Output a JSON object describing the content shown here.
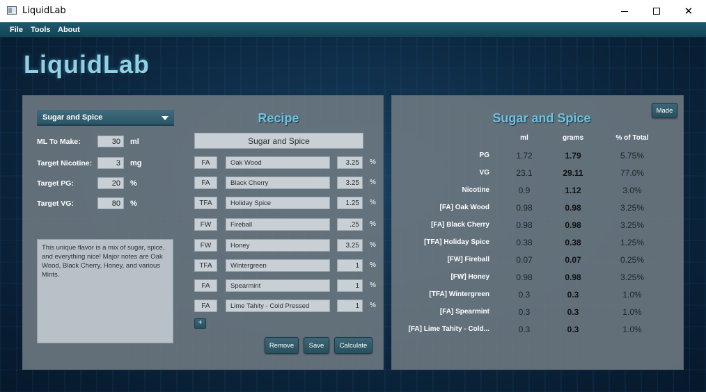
{
  "window": {
    "title": "LiquidLab",
    "controls": {
      "minimize": "–",
      "maximize": "□",
      "close": "✕"
    }
  },
  "menu": [
    "File",
    "Tools",
    "About"
  ],
  "logo": "LiquidLab",
  "left_panel": {
    "recipe_select": "Sugar and Spice",
    "params": [
      {
        "label": "ML To Make:",
        "value": "30",
        "unit": "ml"
      },
      {
        "label": "Target Nicotine:",
        "value": "3",
        "unit": "mg"
      },
      {
        "label": "Target PG:",
        "value": "20",
        "unit": "%"
      },
      {
        "label": "Target VG:",
        "value": "80",
        "unit": "%"
      }
    ],
    "description": "This unique flavor is a mix of sugar, spice, and everything nice! Major notes are Oak Wood, Black Cherry, Honey, and various Mints."
  },
  "recipe": {
    "title": "Recipe",
    "name": "Sugar and Spice",
    "flavors": [
      {
        "brand": "FA",
        "name": "Oak Wood",
        "pct": "3.25",
        "unit": "%"
      },
      {
        "brand": "FA",
        "name": "Black Cherry",
        "pct": "3.25",
        "unit": "%"
      },
      {
        "brand": "TFA",
        "name": "Holiday Spice",
        "pct": "1.25",
        "unit": "%"
      },
      {
        "brand": "FW",
        "name": "Fireball",
        "pct": ".25",
        "unit": "%"
      },
      {
        "brand": "FW",
        "name": "Honey",
        "pct": "3.25",
        "unit": "%"
      },
      {
        "brand": "TFA",
        "name": "Wintergreen",
        "pct": "1",
        "unit": "%"
      },
      {
        "brand": "FA",
        "name": "Spearmint",
        "pct": "1",
        "unit": "%"
      },
      {
        "brand": "FA",
        "name": "Lime Tahity - Cold Pressed",
        "pct": "1",
        "unit": "%"
      }
    ],
    "add_label": "+",
    "buttons": {
      "remove": "Remove",
      "save": "Save",
      "calculate": "Calculate"
    }
  },
  "results": {
    "made_label": "Made",
    "title": "Sugar and Spice",
    "columns": {
      "ml": "ml",
      "grams": "grams",
      "pct": "% of Total"
    },
    "rows": [
      {
        "label": "PG",
        "ml": "1.72",
        "grams": "1.79",
        "pct": "5.75%"
      },
      {
        "label": "VG",
        "ml": "23.1",
        "grams": "29.11",
        "pct": "77.0%"
      },
      {
        "label": "Nicotine",
        "ml": "0.9",
        "grams": "1.12",
        "pct": "3.0%"
      },
      {
        "label": "[FA] Oak Wood",
        "ml": "0.98",
        "grams": "0.98",
        "pct": "3.25%"
      },
      {
        "label": "[FA] Black Cherry",
        "ml": "0.98",
        "grams": "0.98",
        "pct": "3.25%"
      },
      {
        "label": "[TFA] Holiday Spice",
        "ml": "0.38",
        "grams": "0.38",
        "pct": "1.25%"
      },
      {
        "label": "[FW] Fireball",
        "ml": "0.07",
        "grams": "0.07",
        "pct": "0.25%"
      },
      {
        "label": "[FW] Honey",
        "ml": "0.98",
        "grams": "0.98",
        "pct": "3.25%"
      },
      {
        "label": "[TFA] Wintergreen",
        "ml": "0.3",
        "grams": "0.3",
        "pct": "1.0%"
      },
      {
        "label": "[FA] Spearmint",
        "ml": "0.3",
        "grams": "0.3",
        "pct": "1.0%"
      },
      {
        "label": "[FA] Lime Tahity - Cold...",
        "ml": "0.3",
        "grams": "0.3",
        "pct": "1.0%"
      }
    ]
  }
}
